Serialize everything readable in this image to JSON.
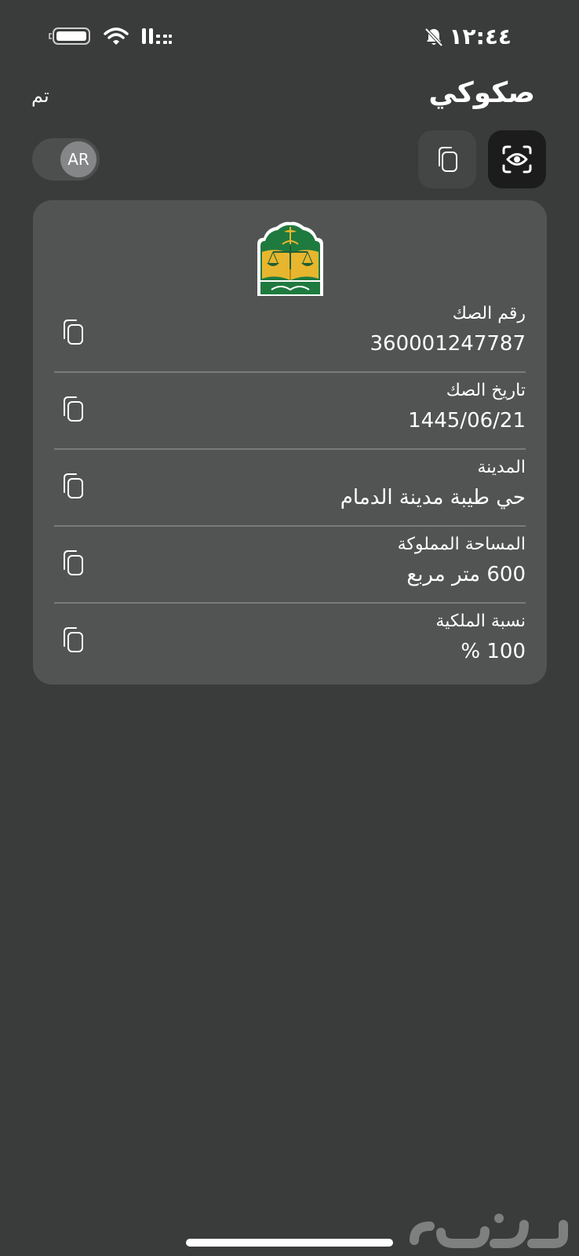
{
  "status_bar": {
    "time": "١٢:٤٤",
    "icons": [
      "battery-icon",
      "wifi-icon",
      "signal-icon",
      "bell-muted-icon"
    ]
  },
  "header": {
    "title": "صكوكي",
    "done_label": "تم"
  },
  "toolbar": {
    "language_label": "AR",
    "icons": [
      "eye-scan-icon",
      "copy-icon"
    ]
  },
  "card": {
    "emblem": "ministry-of-justice-emblem",
    "rows": [
      {
        "label": "رقم الصك",
        "value": "360001247787"
      },
      {
        "label": "تاريخ الصك",
        "value": "1445/06/21"
      },
      {
        "label": "المدينة",
        "value": "حي طيبة  مدينة الدمام"
      },
      {
        "label": "المساحة المملوكة",
        "value": "600 متر مربع"
      },
      {
        "label": "نسبة الملكية",
        "value": "100 %"
      }
    ]
  },
  "watermark": {
    "icon": "haraj-watermark"
  },
  "colors": {
    "background": "#3a3b3b",
    "card": "#525353",
    "scan_button": "#1c1c1d",
    "emblem_green": "#1f7a3f",
    "emblem_gold": "#e7b62e"
  }
}
